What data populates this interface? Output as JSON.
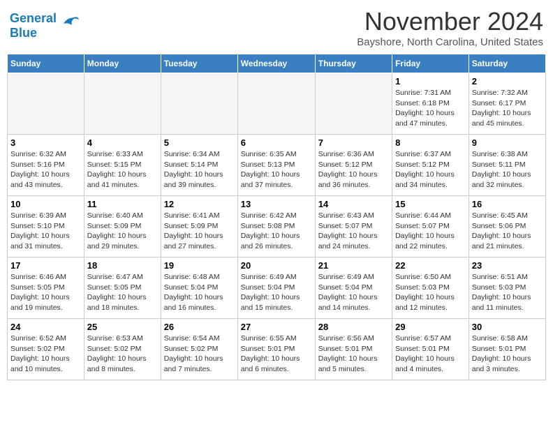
{
  "header": {
    "logo_general": "General",
    "logo_blue": "Blue",
    "month": "November 2024",
    "location": "Bayshore, North Carolina, United States"
  },
  "weekdays": [
    "Sunday",
    "Monday",
    "Tuesday",
    "Wednesday",
    "Thursday",
    "Friday",
    "Saturday"
  ],
  "weeks": [
    [
      {
        "day": "",
        "info": ""
      },
      {
        "day": "",
        "info": ""
      },
      {
        "day": "",
        "info": ""
      },
      {
        "day": "",
        "info": ""
      },
      {
        "day": "",
        "info": ""
      },
      {
        "day": "1",
        "info": "Sunrise: 7:31 AM\nSunset: 6:18 PM\nDaylight: 10 hours\nand 47 minutes."
      },
      {
        "day": "2",
        "info": "Sunrise: 7:32 AM\nSunset: 6:17 PM\nDaylight: 10 hours\nand 45 minutes."
      }
    ],
    [
      {
        "day": "3",
        "info": "Sunrise: 6:32 AM\nSunset: 5:16 PM\nDaylight: 10 hours\nand 43 minutes."
      },
      {
        "day": "4",
        "info": "Sunrise: 6:33 AM\nSunset: 5:15 PM\nDaylight: 10 hours\nand 41 minutes."
      },
      {
        "day": "5",
        "info": "Sunrise: 6:34 AM\nSunset: 5:14 PM\nDaylight: 10 hours\nand 39 minutes."
      },
      {
        "day": "6",
        "info": "Sunrise: 6:35 AM\nSunset: 5:13 PM\nDaylight: 10 hours\nand 37 minutes."
      },
      {
        "day": "7",
        "info": "Sunrise: 6:36 AM\nSunset: 5:12 PM\nDaylight: 10 hours\nand 36 minutes."
      },
      {
        "day": "8",
        "info": "Sunrise: 6:37 AM\nSunset: 5:12 PM\nDaylight: 10 hours\nand 34 minutes."
      },
      {
        "day": "9",
        "info": "Sunrise: 6:38 AM\nSunset: 5:11 PM\nDaylight: 10 hours\nand 32 minutes."
      }
    ],
    [
      {
        "day": "10",
        "info": "Sunrise: 6:39 AM\nSunset: 5:10 PM\nDaylight: 10 hours\nand 31 minutes."
      },
      {
        "day": "11",
        "info": "Sunrise: 6:40 AM\nSunset: 5:09 PM\nDaylight: 10 hours\nand 29 minutes."
      },
      {
        "day": "12",
        "info": "Sunrise: 6:41 AM\nSunset: 5:09 PM\nDaylight: 10 hours\nand 27 minutes."
      },
      {
        "day": "13",
        "info": "Sunrise: 6:42 AM\nSunset: 5:08 PM\nDaylight: 10 hours\nand 26 minutes."
      },
      {
        "day": "14",
        "info": "Sunrise: 6:43 AM\nSunset: 5:07 PM\nDaylight: 10 hours\nand 24 minutes."
      },
      {
        "day": "15",
        "info": "Sunrise: 6:44 AM\nSunset: 5:07 PM\nDaylight: 10 hours\nand 22 minutes."
      },
      {
        "day": "16",
        "info": "Sunrise: 6:45 AM\nSunset: 5:06 PM\nDaylight: 10 hours\nand 21 minutes."
      }
    ],
    [
      {
        "day": "17",
        "info": "Sunrise: 6:46 AM\nSunset: 5:05 PM\nDaylight: 10 hours\nand 19 minutes."
      },
      {
        "day": "18",
        "info": "Sunrise: 6:47 AM\nSunset: 5:05 PM\nDaylight: 10 hours\nand 18 minutes."
      },
      {
        "day": "19",
        "info": "Sunrise: 6:48 AM\nSunset: 5:04 PM\nDaylight: 10 hours\nand 16 minutes."
      },
      {
        "day": "20",
        "info": "Sunrise: 6:49 AM\nSunset: 5:04 PM\nDaylight: 10 hours\nand 15 minutes."
      },
      {
        "day": "21",
        "info": "Sunrise: 6:49 AM\nSunset: 5:04 PM\nDaylight: 10 hours\nand 14 minutes."
      },
      {
        "day": "22",
        "info": "Sunrise: 6:50 AM\nSunset: 5:03 PM\nDaylight: 10 hours\nand 12 minutes."
      },
      {
        "day": "23",
        "info": "Sunrise: 6:51 AM\nSunset: 5:03 PM\nDaylight: 10 hours\nand 11 minutes."
      }
    ],
    [
      {
        "day": "24",
        "info": "Sunrise: 6:52 AM\nSunset: 5:02 PM\nDaylight: 10 hours\nand 10 minutes."
      },
      {
        "day": "25",
        "info": "Sunrise: 6:53 AM\nSunset: 5:02 PM\nDaylight: 10 hours\nand 8 minutes."
      },
      {
        "day": "26",
        "info": "Sunrise: 6:54 AM\nSunset: 5:02 PM\nDaylight: 10 hours\nand 7 minutes."
      },
      {
        "day": "27",
        "info": "Sunrise: 6:55 AM\nSunset: 5:01 PM\nDaylight: 10 hours\nand 6 minutes."
      },
      {
        "day": "28",
        "info": "Sunrise: 6:56 AM\nSunset: 5:01 PM\nDaylight: 10 hours\nand 5 minutes."
      },
      {
        "day": "29",
        "info": "Sunrise: 6:57 AM\nSunset: 5:01 PM\nDaylight: 10 hours\nand 4 minutes."
      },
      {
        "day": "30",
        "info": "Sunrise: 6:58 AM\nSunset: 5:01 PM\nDaylight: 10 hours\nand 3 minutes."
      }
    ]
  ]
}
